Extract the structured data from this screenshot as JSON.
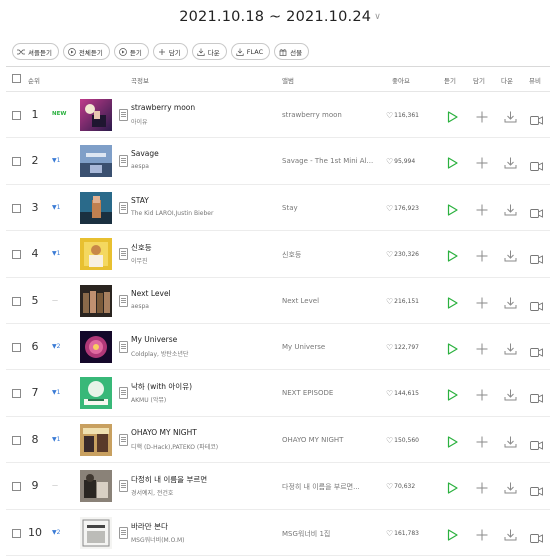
{
  "header": {
    "date_range": "2021.10.18 ~ 2021.10.24",
    "chevron_icon": "chevron-down-icon"
  },
  "toolbar": {
    "shuffle": "셔플듣기",
    "play_all": "전체듣기",
    "play": "듣기",
    "add": "담기",
    "download": "다운",
    "flac": "FLAC",
    "gift": "선물"
  },
  "columns": {
    "rank": "순위",
    "song_info": "곡정보",
    "album": "앨범",
    "likes": "좋아요",
    "play": "듣기",
    "add": "담기",
    "download": "다운",
    "mv": "뮤비"
  },
  "colors": {
    "play": "#2bb13f",
    "up": "#3a7bd5",
    "new": "#2bb13f"
  },
  "songs": [
    {
      "rank": "1",
      "change": "NEW",
      "change_type": "new",
      "title": "strawberry moon",
      "artist": "아이유",
      "album": "strawberry moon",
      "likes": "116,361"
    },
    {
      "rank": "2",
      "change": "▼1",
      "change_type": "up",
      "title": "Savage",
      "artist": "aespa",
      "album": "Savage - The 1st Mini Al...",
      "likes": "95,994"
    },
    {
      "rank": "3",
      "change": "▼1",
      "change_type": "up",
      "title": "STAY",
      "artist": "The Kid LAROI,Justin Bieber",
      "album": "Stay",
      "likes": "176,923"
    },
    {
      "rank": "4",
      "change": "▼1",
      "change_type": "up",
      "title": "신호등",
      "artist": "이무진",
      "album": "신호등",
      "likes": "230,326"
    },
    {
      "rank": "5",
      "change": "—",
      "change_type": "same",
      "title": "Next Level",
      "artist": "aespa",
      "album": "Next Level",
      "likes": "216,151"
    },
    {
      "rank": "6",
      "change": "▼2",
      "change_type": "up",
      "title": "My Universe",
      "artist": "Coldplay, 방탄소년단",
      "album": "My Universe",
      "likes": "122,797"
    },
    {
      "rank": "7",
      "change": "▼1",
      "change_type": "up",
      "title": "낙하 (with 아이유)",
      "artist": "AKMU (악뮤)",
      "album": "NEXT EPISODE",
      "likes": "144,615"
    },
    {
      "rank": "8",
      "change": "▼1",
      "change_type": "up",
      "title": "OHAYO MY NIGHT",
      "artist": "디핵 (D-Hack),PATEKO (파테코)",
      "album": "OHAYO MY NIGHT",
      "likes": "150,560"
    },
    {
      "rank": "9",
      "change": "—",
      "change_type": "same",
      "title": "다정히 내 이름을 부르면",
      "artist": "경서예지, 전건호",
      "album": "다정히 내 이름을 부르면...",
      "likes": "70,632"
    },
    {
      "rank": "10",
      "change": "▼2",
      "change_type": "up",
      "title": "바라만 본다",
      "artist": "MSG워너비(M.O.M)",
      "album": "MSG워너비 1집",
      "likes": "161,783"
    }
  ]
}
